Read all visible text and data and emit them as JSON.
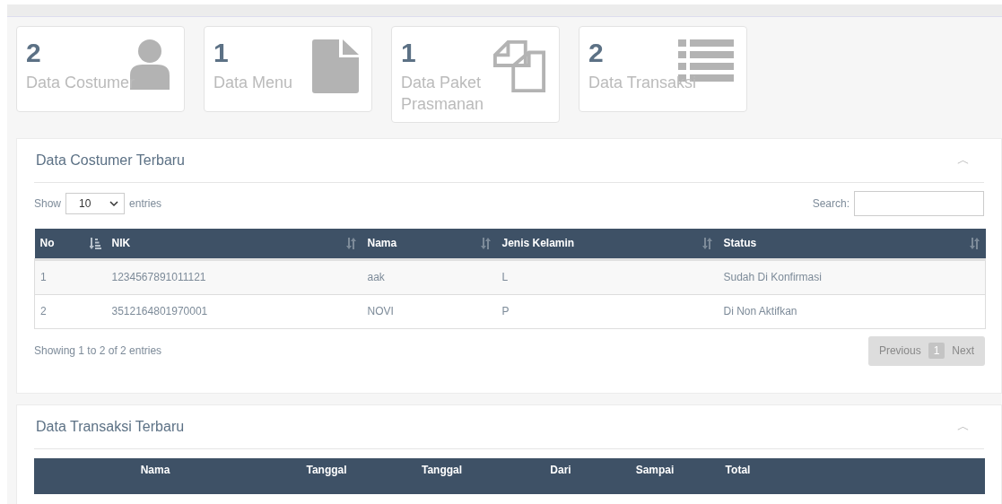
{
  "stats": [
    {
      "count": "2",
      "label": "Data Costumer",
      "kind": "user"
    },
    {
      "count": "1",
      "label": "Data Menu",
      "kind": "file"
    },
    {
      "count": "1",
      "label": "Data Paket Prasmanan",
      "kind": "copy"
    },
    {
      "count": "2",
      "label": "Data Transaksi",
      "kind": "list"
    }
  ],
  "customer_panel": {
    "title": "Data Costumer Terbaru",
    "collapse_icon": "︿",
    "length": {
      "show_label": "Show",
      "value": "10",
      "entries_label": "entries"
    },
    "search": {
      "label": "Search:"
    },
    "columns": [
      {
        "label": "No",
        "sorted": true
      },
      {
        "label": "NIK",
        "sorted": false
      },
      {
        "label": "Nama",
        "sorted": false
      },
      {
        "label": "Jenis Kelamin",
        "sorted": false
      },
      {
        "label": "Status",
        "sorted": false
      }
    ],
    "rows": [
      [
        "1",
        "1234567891011121",
        "aak",
        "L",
        "Sudah Di Konfirmasi"
      ],
      [
        "2",
        "3512164801970001",
        "NOVI",
        "P",
        "Di Non Aktifkan"
      ]
    ],
    "info": "Showing 1 to 2 of 2 entries",
    "pagination": {
      "previous": "Previous",
      "page": "1",
      "next": "Next"
    }
  },
  "transaction_panel": {
    "title": "Data Transaksi Terbaru",
    "collapse_icon": "︿",
    "columns": [
      "Nama",
      "Tanggal",
      "Tanggal",
      "Dari",
      "Sampai",
      "Total"
    ]
  }
}
